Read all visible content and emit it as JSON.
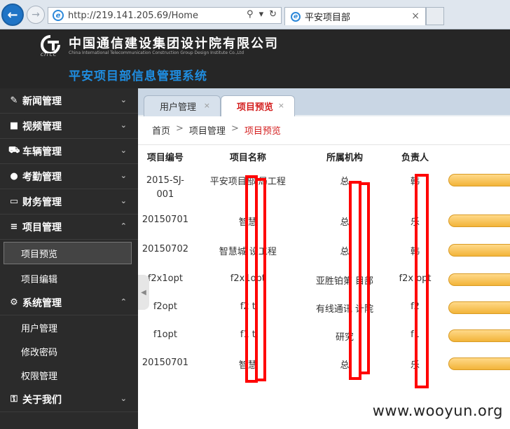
{
  "browser": {
    "url": "http://219.141.205.69/Home",
    "tab_title": "平安项目部",
    "tab_close": "×",
    "address_tools": [
      "⚲",
      "▾",
      "↻"
    ]
  },
  "header": {
    "logo_sub": "CITCC",
    "company_name": "中国通信建设集团设计院有限公司",
    "company_en": "China International Telecommunication Construction Group Design Institute Co.,Ltd",
    "system_title": "平安项目部信息管理系统"
  },
  "sidebar": {
    "items": [
      {
        "label": "新闻管理",
        "icon": "edit-icon",
        "glyph": "✎",
        "chevron": "⌄"
      },
      {
        "label": "视频管理",
        "icon": "video-icon",
        "glyph": "■",
        "chevron": "⌄"
      },
      {
        "label": "车辆管理",
        "icon": "truck-icon",
        "glyph": "⛟",
        "chevron": "⌄"
      },
      {
        "label": "考勤管理",
        "icon": "user-icon",
        "glyph": "●",
        "chevron": "⌄"
      },
      {
        "label": "财务管理",
        "icon": "credit-card-icon",
        "glyph": "▭",
        "chevron": "⌄"
      },
      {
        "label": "项目管理",
        "icon": "list-icon",
        "glyph": "≡",
        "chevron": "⌃",
        "children": [
          "项目预览",
          "项目编辑"
        ]
      },
      {
        "label": "系统管理",
        "icon": "gears-icon",
        "glyph": "⚙",
        "chevron": "⌃",
        "children": [
          "用户管理",
          "修改密码",
          "权限管理"
        ]
      },
      {
        "label": "关于我们",
        "icon": "key-icon",
        "glyph": "⚿",
        "chevron": "⌄"
      }
    ]
  },
  "tabs": [
    {
      "label": "用户管理",
      "close": "×"
    },
    {
      "label": "项目预览",
      "close": "×"
    }
  ],
  "breadcrumb": {
    "home": "首页",
    "section": "项目管理",
    "current": "项目预览",
    "sep": ">"
  },
  "table": {
    "headers": [
      "项目编号",
      "项目名称",
      "所属机构",
      "负责人"
    ],
    "rows": [
      [
        "2015-SJ-001",
        "平安项目部 局工程",
        "总",
        "韩"
      ],
      [
        "20150701",
        "智慧 ",
        "总",
        "乐"
      ],
      [
        "20150702",
        "智慧城 设工程",
        "总",
        "韩"
      ],
      [
        "f2x1opt",
        "f2x1opt",
        "亚胜铂第 目部",
        "f2x opt"
      ],
      [
        "f2opt",
        "f2 t",
        "有线通讯 计院",
        "f2"
      ],
      [
        "f1opt",
        "f1 t",
        "研究",
        "f1"
      ],
      [
        "20150701",
        "智慧 ",
        "总",
        "乐"
      ]
    ]
  },
  "collapse_glyph": "◀",
  "watermark": "www.wooyun.org"
}
